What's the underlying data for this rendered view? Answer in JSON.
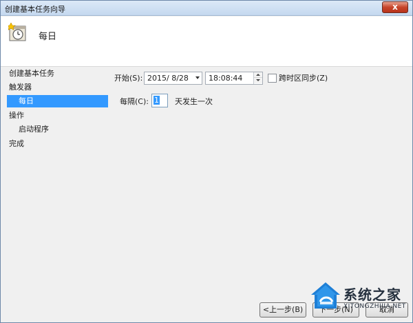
{
  "window": {
    "title": "创建基本任务向导",
    "close_label": "x"
  },
  "header": {
    "title": "每日",
    "icon": "scheduled-task-clock-icon"
  },
  "sidebar": {
    "items": [
      {
        "label": "创建基本任务",
        "selected": false
      },
      {
        "label": "触发器",
        "selected": false
      },
      {
        "label": "每日",
        "selected": true
      },
      {
        "label": "操作",
        "selected": false
      },
      {
        "label": "启动程序",
        "selected": false
      },
      {
        "label": "完成",
        "selected": false
      }
    ]
  },
  "form": {
    "start_label": "开始(S):",
    "date_value": "2015/ 8/28",
    "time_value": "18:08:44",
    "sync_timezone_label": "跨时区同步(Z)",
    "sync_timezone_checked": false,
    "recur_label": "每隔(C):",
    "recur_value": "1",
    "recur_suffix": "天发生一次"
  },
  "footer": {
    "back_label": "<上一步(B)",
    "next_label": "下一步(N)",
    "cancel_label": "取消"
  },
  "watermark": {
    "brand": "系统之家",
    "url": "XITONGZHIJIA.NET"
  },
  "colors": {
    "selection": "#3399ff",
    "title_bar": "#c4d8ef",
    "close_button": "#c7452b"
  }
}
